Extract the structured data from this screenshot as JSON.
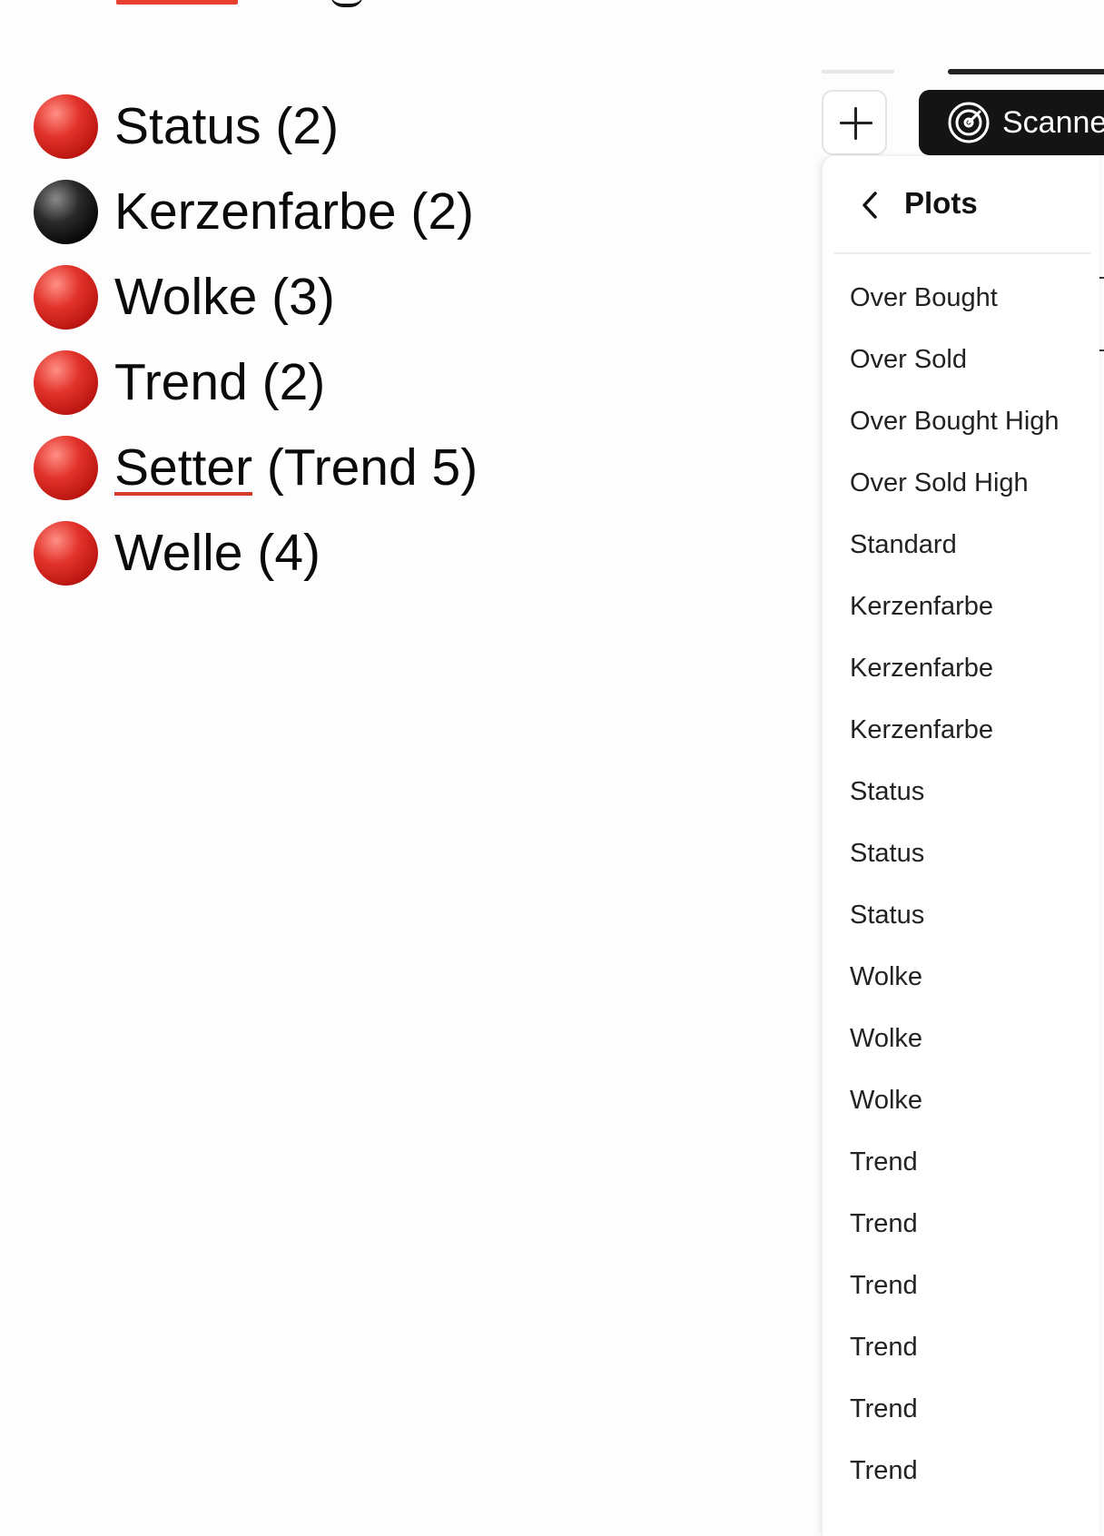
{
  "legend": {
    "items": [
      {
        "label": "Status (2)",
        "dot_color": "#d42a22"
      },
      {
        "label": "Kerzenfarbe (2)",
        "dot_color": "#000000"
      },
      {
        "label": "Wolke (3)",
        "dot_color": "#d42a22"
      },
      {
        "label": "Trend (2)",
        "dot_color": "#d42a22"
      },
      {
        "label_underlined": "Setter",
        "label_rest": " (Trend 5)",
        "dot_color": "#d42a22"
      },
      {
        "label": "Welle (4)",
        "dot_color": "#d42a22"
      }
    ]
  },
  "toolbar": {
    "add_icon": "plus-icon",
    "scanner_icon": "target-icon",
    "scanner_label": "Scanne"
  },
  "plots_panel": {
    "back_icon": "chevron-left-icon",
    "title": "Plots",
    "items": [
      "Over Bought",
      "Over Sold",
      "Over Bought High",
      "Over Sold High",
      "Standard",
      "Kerzenfarbe",
      "Kerzenfarbe",
      "Kerzenfarbe",
      "Status",
      "Status",
      "Status",
      "Wolke",
      "Wolke",
      "Wolke",
      "Trend",
      "Trend",
      "Trend",
      "Trend",
      "Trend",
      "Trend"
    ]
  },
  "colors": {
    "accent_red": "#e8402f",
    "scanner_bg": "#141414"
  }
}
